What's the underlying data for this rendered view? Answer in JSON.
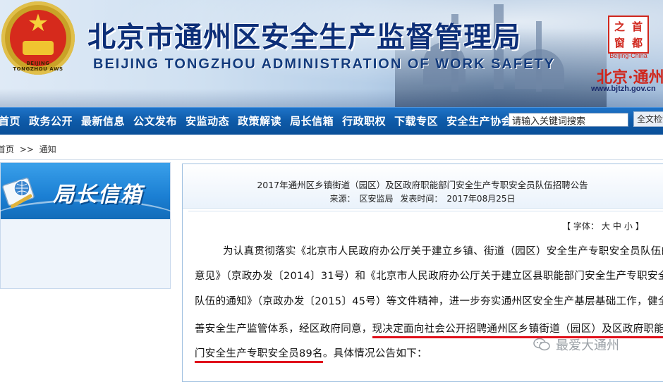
{
  "header": {
    "title_cn": "北京市通州区安全生产监督管理局",
    "title_en": "BEIJING TONGZHOU ADMINISTRATION OF WORK SAFETY",
    "emblem_text": "BEIJING TONGZHOU AWS",
    "seal_chars": [
      "首",
      "都",
      "之",
      "窗"
    ],
    "seal_caption": "Beijing-China",
    "calligraphy": "北京·通州",
    "site_url": "www.bjtzh.gov.cn"
  },
  "nav": {
    "items": [
      "首页",
      "政务公开",
      "最新信息",
      "公文发布",
      "安监动态",
      "政策解读",
      "局长信箱",
      "行政职权",
      "下载专区",
      "安全生产协会"
    ],
    "search_placeholder": "请输入关键词搜索",
    "search_button": "全文检索"
  },
  "breadcrumb": {
    "home": "首页",
    "sep": ">>",
    "current": "通知"
  },
  "left_box": {
    "title": "局长信箱"
  },
  "article": {
    "title": "2017年通州区乡镇街道（园区）及区政府职能部门安全生产专职安全员队伍招聘公告",
    "source_label": "来源：",
    "source": "区安监局",
    "date_label": "发表时间：",
    "date": "2017年08月25日",
    "font_size_label": "【 字体：",
    "font_large": "大",
    "font_medium": "中",
    "font_small": "小",
    "font_close": "】",
    "lines": [
      "为认真贯彻落实《北京市人民政府办公厅关于建立乡镇、街道（园区）安全生产专职安全员队伍的",
      "意见》（京政办发〔2014〕31号）和《北京市人民政府办公厅关于建立区县职能部门安全生产专职安全员",
      "队伍的通知》（京政办发〔2015〕45号）等文件精神，进一步夯实通州区安全生产基层基础工作，健全完",
      "善安全生产监管体系，经区政府同意，",
      "现决定面向社会公开招聘通州区乡镇街道（园区）及区政府职能部",
      "门安全生产专职安全员89名",
      "。具体情况公告如下："
    ]
  },
  "watermark": {
    "text": "最爱大通州"
  },
  "colors": {
    "nav_blue": "#0e5aa8",
    "title_blue": "#0d2f78",
    "highlight_red": "#e0101a",
    "seal_red": "#d0271d"
  }
}
